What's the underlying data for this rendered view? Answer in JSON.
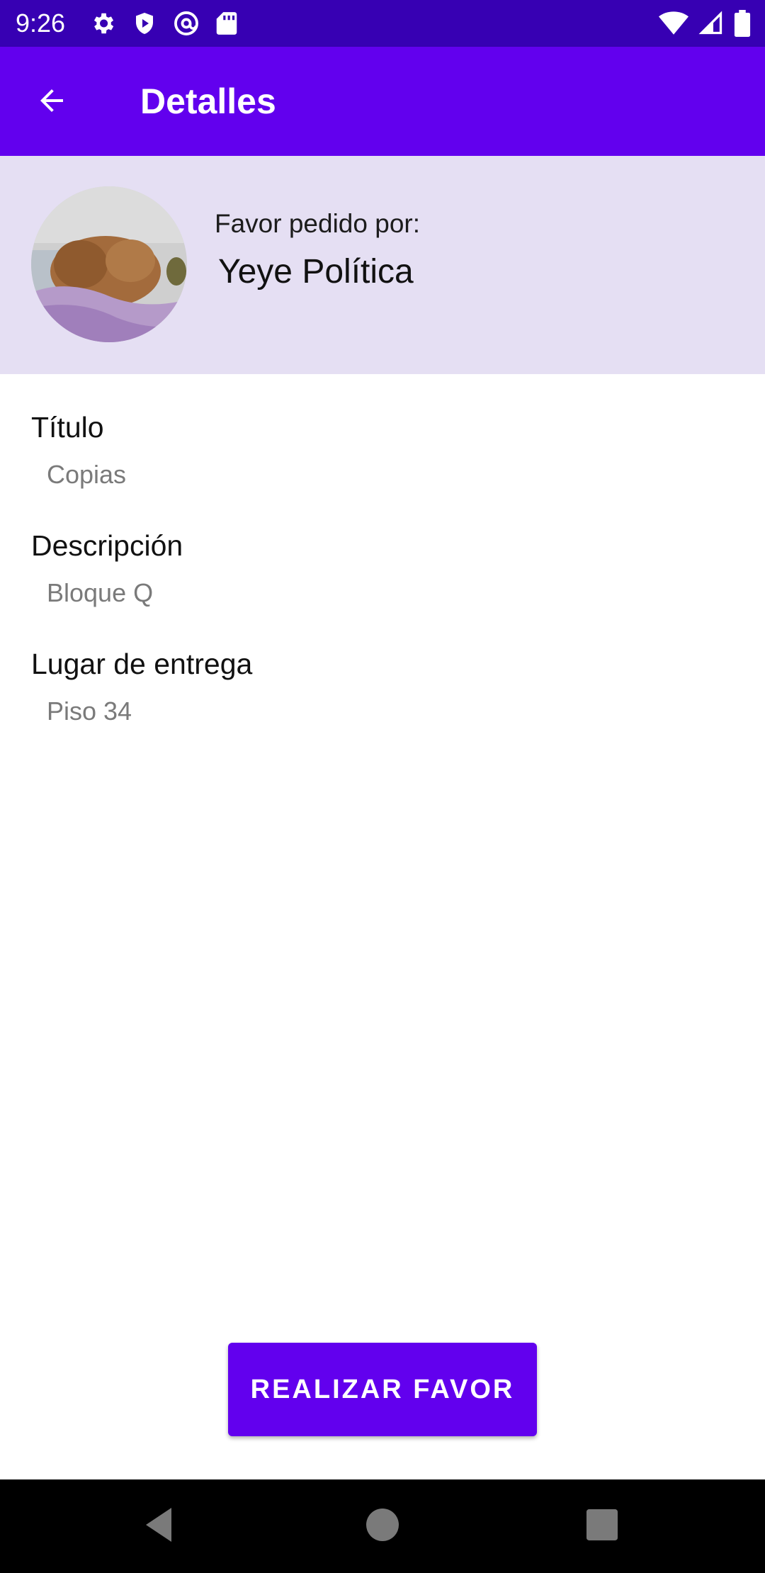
{
  "status_bar": {
    "time": "9:26",
    "left_icons": [
      "gear-icon",
      "shield-play-icon",
      "at-sign-icon",
      "sd-card-icon"
    ],
    "right_icons": [
      "wifi-icon",
      "cell-signal-icon",
      "battery-icon"
    ]
  },
  "app_bar": {
    "back_icon": "arrow-back-icon",
    "title": "Detalles"
  },
  "requester": {
    "label": "Favor pedido por:",
    "name": "Yeye Política",
    "avatar": "dog-sleeping-photo"
  },
  "fields": [
    {
      "label": "Título",
      "value": "Copias"
    },
    {
      "label": "Descripción",
      "value": "Bloque Q"
    },
    {
      "label": "Lugar de entrega",
      "value": "Piso 34"
    }
  ],
  "action_button": {
    "label": "REALIZAR FAVOR"
  },
  "nav_bar": {
    "icons": [
      "back-triangle-icon",
      "home-circle-icon",
      "recents-square-icon"
    ]
  },
  "colors": {
    "status_bar": "#3700b3",
    "primary": "#6200ee",
    "header_card": "#e5dff3"
  }
}
